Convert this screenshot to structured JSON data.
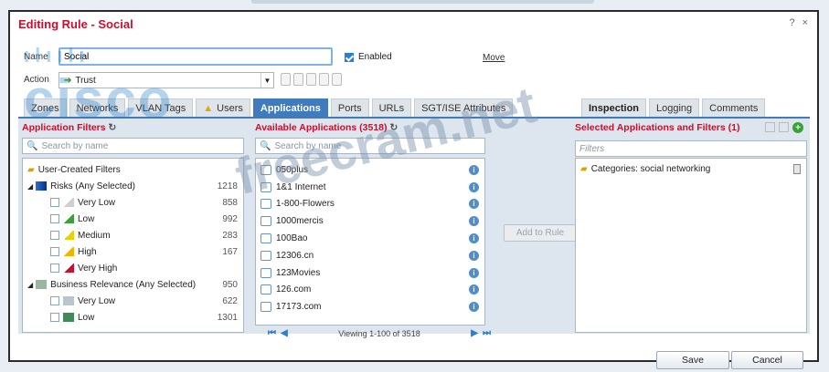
{
  "dialog": {
    "title": "Editing Rule - Social",
    "help": "?",
    "close": "×"
  },
  "form": {
    "name_label": "Name",
    "name_value": "Social",
    "enabled_label": "Enabled",
    "move_label": "Move",
    "action_label": "Action",
    "action_value": "Trust"
  },
  "tabs": [
    {
      "label": "Zones"
    },
    {
      "label": "Networks"
    },
    {
      "label": "VLAN Tags"
    },
    {
      "label": "Users"
    },
    {
      "label": "Applications"
    },
    {
      "label": "Ports"
    },
    {
      "label": "URLs"
    },
    {
      "label": "SGT/ISE Attributes"
    }
  ],
  "tabs_right": [
    {
      "label": "Inspection"
    },
    {
      "label": "Logging"
    },
    {
      "label": "Comments"
    }
  ],
  "filters": {
    "title": "Application Filters",
    "search_placeholder": "Search by name",
    "items": [
      {
        "label": "User-Created Filters",
        "count": ""
      },
      {
        "label": "Risks (Any Selected)",
        "count": "1218"
      },
      {
        "label": "Very Low",
        "count": "858"
      },
      {
        "label": "Low",
        "count": "992"
      },
      {
        "label": "Medium",
        "count": "283"
      },
      {
        "label": "High",
        "count": "167"
      },
      {
        "label": "Very High",
        "count": ""
      },
      {
        "label": "Business Relevance (Any Selected)",
        "count": "950"
      },
      {
        "label": "Very Low",
        "count": "622"
      },
      {
        "label": "Low",
        "count": "1301"
      }
    ]
  },
  "available": {
    "title": "Available Applications (3518)",
    "search_placeholder": "Search by name",
    "apps": [
      "050plus",
      "1&1 Internet",
      "1-800-Flowers",
      "1000mercis",
      "100Bao",
      "12306.cn",
      "123Movies",
      "126.com",
      "17173.com"
    ],
    "pager_text": "Viewing 1-100 of 3518",
    "add_button": "Add to Rule"
  },
  "selected": {
    "title": "Selected Applications and Filters (1)",
    "filters_placeholder": "Filters",
    "items": [
      "Categories: social networking"
    ]
  },
  "buttons": {
    "save": "Save",
    "cancel": "Cancel"
  },
  "watermark": {
    "logo": "cisco",
    "site": "freecram.net"
  },
  "colors": {
    "title_red": "#c8102e",
    "accent_blue": "#3f7bbd"
  }
}
